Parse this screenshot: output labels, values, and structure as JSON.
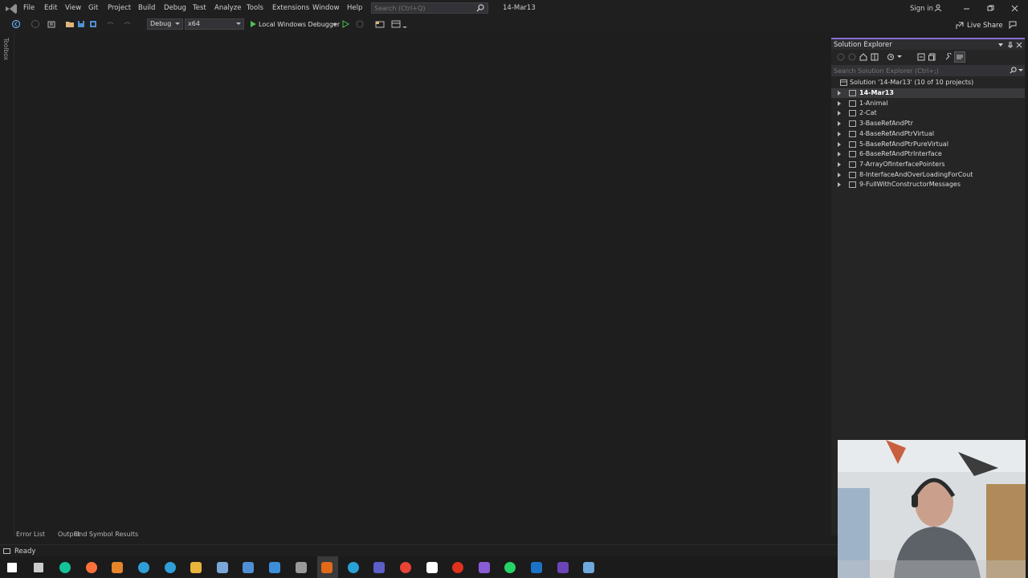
{
  "menu": {
    "items": [
      "File",
      "Edit",
      "View",
      "Git",
      "Project",
      "Build",
      "Debug",
      "Test",
      "Analyze",
      "Tools",
      "Extensions",
      "Window",
      "Help"
    ],
    "search_placeholder": "Search (Ctrl+Q)",
    "solution_name": "14-Mar13",
    "signin_label": "Sign in",
    "live_share_label": "Live Share"
  },
  "toolbar": {
    "configuration": "Debug",
    "platform": "x64",
    "debugger_label": "Local Windows Debugger"
  },
  "toolbox": {
    "label": "Toolbox"
  },
  "solution_explorer": {
    "title": "Solution Explorer",
    "search_placeholder": "Search Solution Explorer (Ctrl+;)",
    "solution_label": "Solution '14-Mar13' (10 of 10 projects)",
    "projects": [
      "14-Mar13",
      "1-Animal",
      "2-Cat",
      "3-BaseRefAndPtr",
      "4-BaseRefAndPtrVirtual",
      "5-BaseRefAndPtrPureVirtual",
      "6-BaseRefAndPtrInterface",
      "7-ArrayOfInterfacePointers",
      "8-InterfaceAndOverLoadingForCout",
      "9-FullWithConstructorMessages"
    ]
  },
  "bottom_tabs": [
    "Error List",
    "Output",
    "Find Symbol Results"
  ],
  "status": {
    "text": "Ready"
  },
  "taskbar": {
    "icons": [
      "windows-start-icon",
      "task-view-icon",
      "grammarly-icon",
      "firefox-icon",
      "app-orange-icon",
      "edge-beta-icon",
      "edge-icon",
      "file-explorer-icon",
      "network-icon",
      "remote-desktop-icon",
      "ie-icon",
      "camera-icon",
      "media-app-icon",
      "refresh-app-icon",
      "teams-icon",
      "chrome-icon",
      "store-icon",
      "opera-icon",
      "visual-studio-icon",
      "whatsapp-icon",
      "outlook-icon",
      "terminal-icon",
      "task-manager-icon"
    ]
  }
}
